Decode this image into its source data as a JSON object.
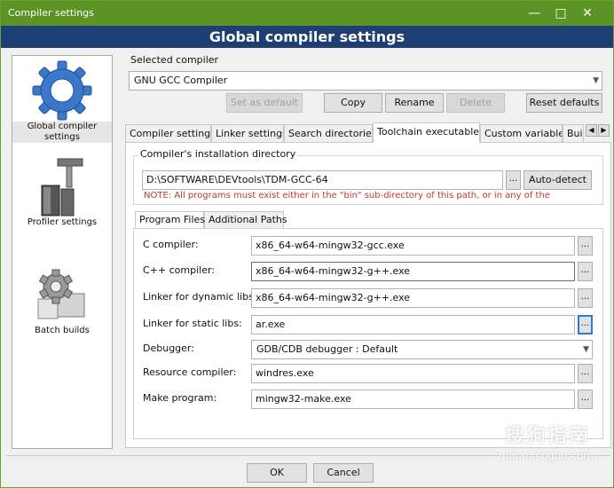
{
  "window": {
    "title": "Compiler settings",
    "banner": "Global compiler settings"
  },
  "sidebar": {
    "items": [
      {
        "label": "Global compiler settings",
        "icon": "gear-icon",
        "selected": true
      },
      {
        "label": "Profiler settings",
        "icon": "caliper-icon"
      },
      {
        "label": "Batch builds",
        "icon": "batch-gears-icon"
      }
    ]
  },
  "compiler": {
    "group_label": "Selected compiler",
    "selected": "GNU GCC Compiler",
    "buttons": {
      "set_default": "Set as default",
      "copy": "Copy",
      "rename": "Rename",
      "delete": "Delete",
      "reset": "Reset defaults"
    }
  },
  "tabs": [
    {
      "label": "Compiler settings"
    },
    {
      "label": "Linker settings"
    },
    {
      "label": "Search directories"
    },
    {
      "label": "Toolchain executables",
      "active": true
    },
    {
      "label": "Custom variables"
    },
    {
      "label": "Bui"
    }
  ],
  "install": {
    "legend": "Compiler's installation directory",
    "path": "D:\\SOFTWARE\\DEVtools\\TDM-GCC-64",
    "browse": "...",
    "auto_detect": "Auto-detect",
    "note": "NOTE: All programs must exist either in the \"bin\" sub-directory of this path, or in any of the"
  },
  "inner_tabs": [
    {
      "label": "Program Files",
      "active": true
    },
    {
      "label": "Additional Paths"
    }
  ],
  "programs": [
    {
      "label": "C compiler:",
      "value": "x86_64-w64-mingw32-gcc.exe"
    },
    {
      "label": "C++ compiler:",
      "value": "x86_64-w64-mingw32-g++.exe"
    },
    {
      "label": "Linker for dynamic libs:",
      "value": "x86_64-w64-mingw32-g++.exe"
    },
    {
      "label": "Linker for static libs:",
      "value": "ar.exe"
    },
    {
      "label": "Debugger:",
      "value": "GDB/CDB debugger : Default"
    },
    {
      "label": "Resource compiler:",
      "value": "windres.exe"
    },
    {
      "label": "Make program:",
      "value": "mingw32-make.exe"
    }
  ],
  "browse_label": "...",
  "footer": {
    "ok": "OK",
    "cancel": "Cancel"
  },
  "watermark": {
    "brand": "搜狗指南",
    "url": "zhinan.sogou.com"
  }
}
